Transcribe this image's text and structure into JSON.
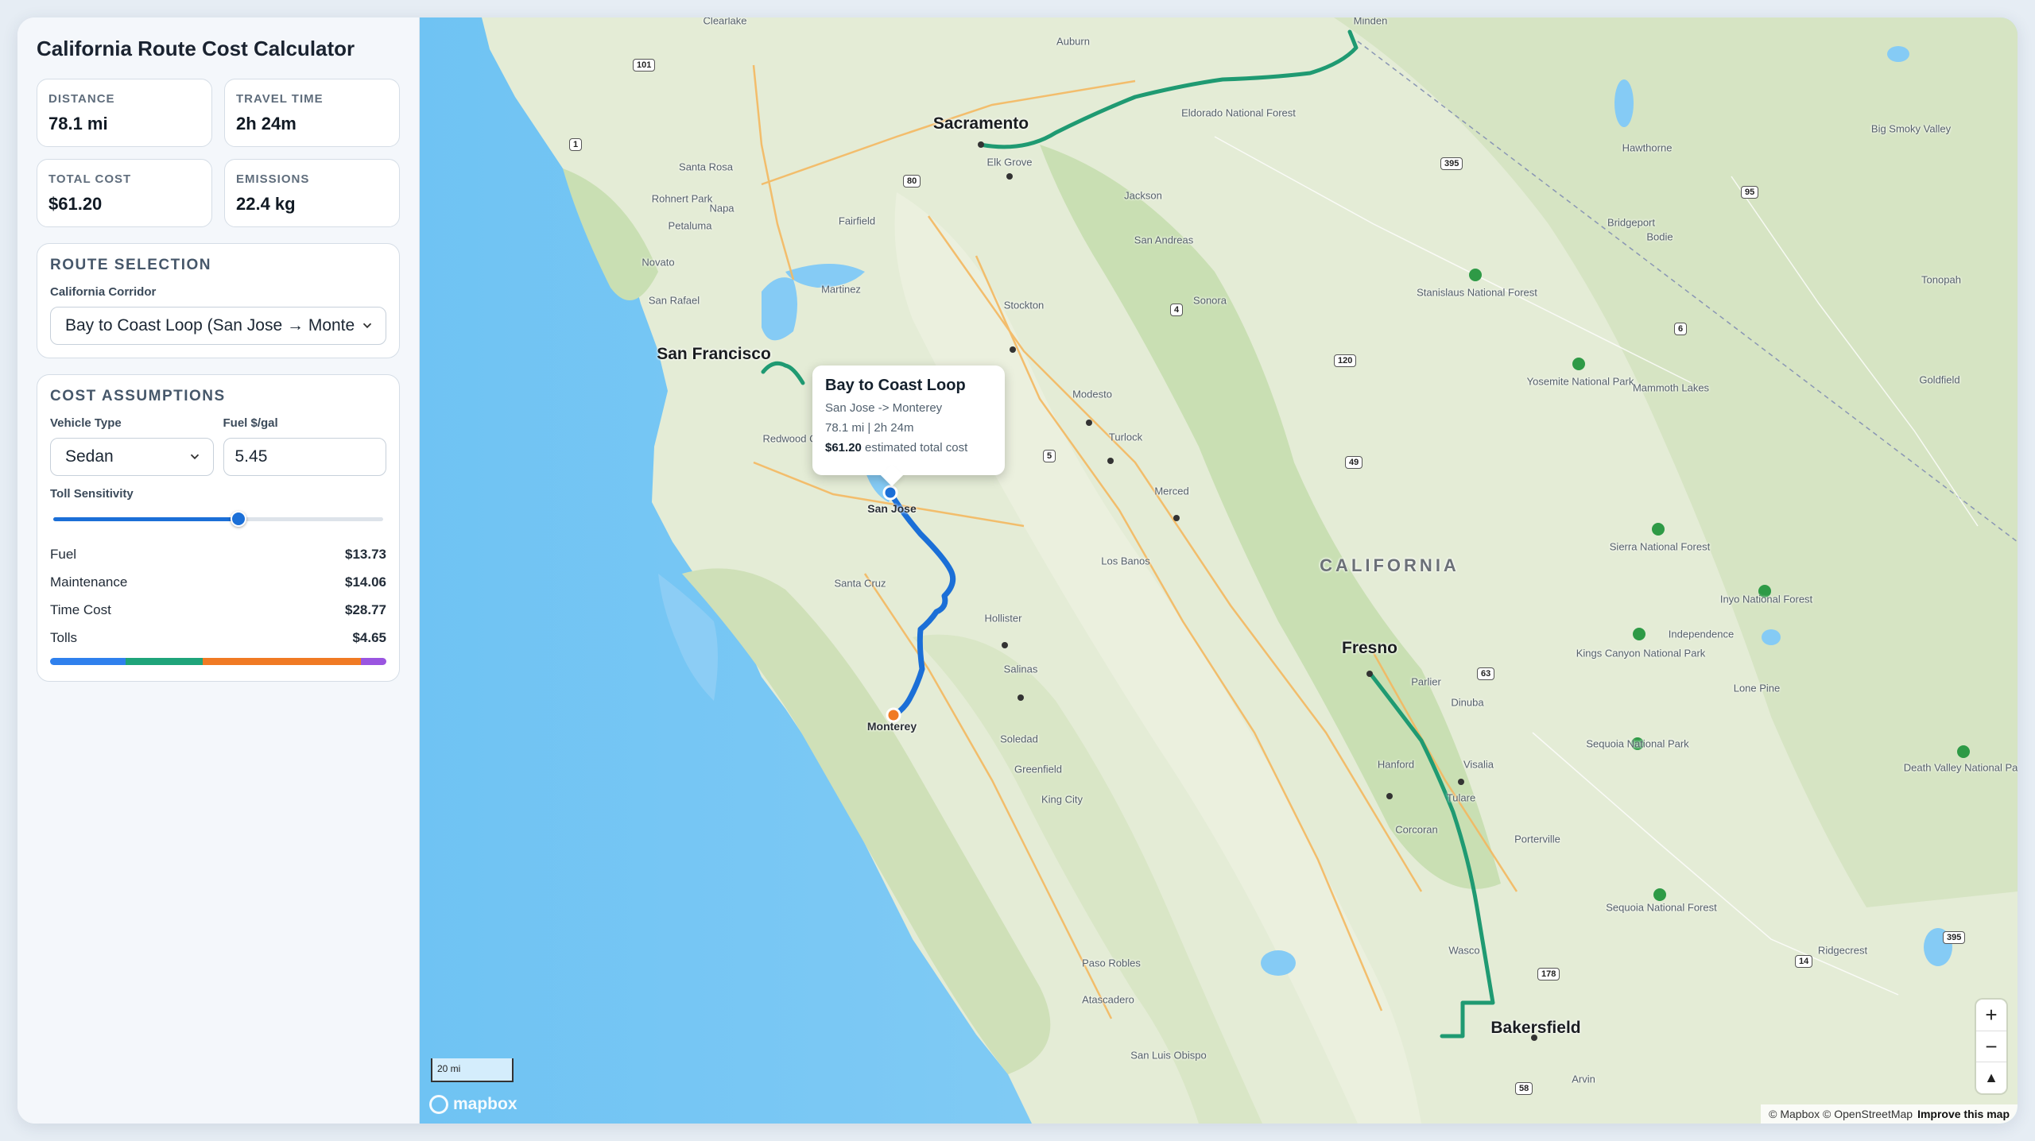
{
  "app_title": "California Route Cost Calculator",
  "stats": [
    {
      "label": "DISTANCE",
      "value": "78.1 mi"
    },
    {
      "label": "TRAVEL TIME",
      "value": "2h 24m"
    },
    {
      "label": "TOTAL COST",
      "value": "$61.20"
    },
    {
      "label": "EMISSIONS",
      "value": "22.4 kg"
    }
  ],
  "route_selection": {
    "title": "ROUTE SELECTION",
    "corridor_label": "California Corridor",
    "corridor_value": "Bay to Coast Loop (San Jose → Monterey)"
  },
  "cost_assumptions": {
    "title": "COST ASSUMPTIONS",
    "vehicle_label": "Vehicle Type",
    "vehicle_value": "Sedan",
    "fuel_label": "Fuel $/gal",
    "fuel_value": "5.45",
    "toll_label": "Toll Sensitivity",
    "toll_fraction": 0.56,
    "rows": [
      {
        "label": "Fuel",
        "value": "$13.73",
        "amount": 13.73,
        "color": "#2f80ed"
      },
      {
        "label": "Maintenance",
        "value": "$14.06",
        "amount": 14.06,
        "color": "#1fa47a"
      },
      {
        "label": "Time Cost",
        "value": "$28.77",
        "amount": 28.77,
        "color": "#f07a24"
      },
      {
        "label": "Tolls",
        "value": "$4.65",
        "amount": 4.65,
        "color": "#9a55e0"
      }
    ]
  },
  "popup": {
    "title": "Bay to Coast Loop",
    "line1": "San Jose -> Monterey",
    "line2": "78.1 mi | 2h 24m",
    "cost_value": "$61.20",
    "cost_suffix": " estimated total cost"
  },
  "map": {
    "region": "CALIFORNIA",
    "major_cities": [
      "Sacramento",
      "San Francisco",
      "Fresno",
      "Bakersfield"
    ],
    "cities": [
      "Santa Rosa",
      "Napa",
      "Fairfield",
      "Petaluma",
      "Novato",
      "Martinez",
      "San Rafael",
      "Stockton",
      "Modesto",
      "Turlock",
      "Merced",
      "Los Banos",
      "Hollister",
      "Salinas",
      "Santa Cruz",
      "Soledad",
      "Greenfield",
      "King City",
      "Paso Robles",
      "Atascadero",
      "San Luis Obispo",
      "Hanford",
      "Visalia",
      "Tulare",
      "Porterville",
      "Corcoran",
      "Wasco",
      "Parlier",
      "Dinuba",
      "Elk Grove",
      "Auburn",
      "Jackson",
      "San Andreas",
      "Sonora",
      "Bridgeport",
      "Bodie",
      "Hawthorne",
      "Mammoth Lakes",
      "Independence",
      "Lone Pine",
      "Tonopah",
      "Goldfield",
      "Ridgecrest",
      "Arvin",
      "Minden",
      "Clearlake",
      "Rohnert Park",
      "Redwood City"
    ],
    "route_cities": [
      "San Jose",
      "Monterey"
    ],
    "parks": [
      "Eldorado National Forest",
      "Stanislaus National Forest",
      "Yosemite National Park",
      "Sierra National Forest",
      "Inyo National Forest",
      "Kings Canyon National Park",
      "Sequoia National Park",
      "Sequoia National Forest",
      "Death Valley National Park",
      "Big Smoky Valley"
    ],
    "scale_label": "20 mi",
    "logo": "mapbox",
    "zoom_in": "+",
    "zoom_out": "−",
    "compass": "▲",
    "attribution": "© Mapbox © OpenStreetMap",
    "improve": "Improve this map",
    "shields": [
      "101",
      "1",
      "80",
      "395",
      "95",
      "4",
      "120",
      "49",
      "6",
      "5",
      "63",
      "178",
      "14",
      "58",
      "395"
    ],
    "colors": {
      "land": "#e4ecd6",
      "forest": "#c9dfb3",
      "water": "#85cbf5",
      "primary_route": "#1b6fd7",
      "alt_route": "#1f9a72"
    }
  }
}
